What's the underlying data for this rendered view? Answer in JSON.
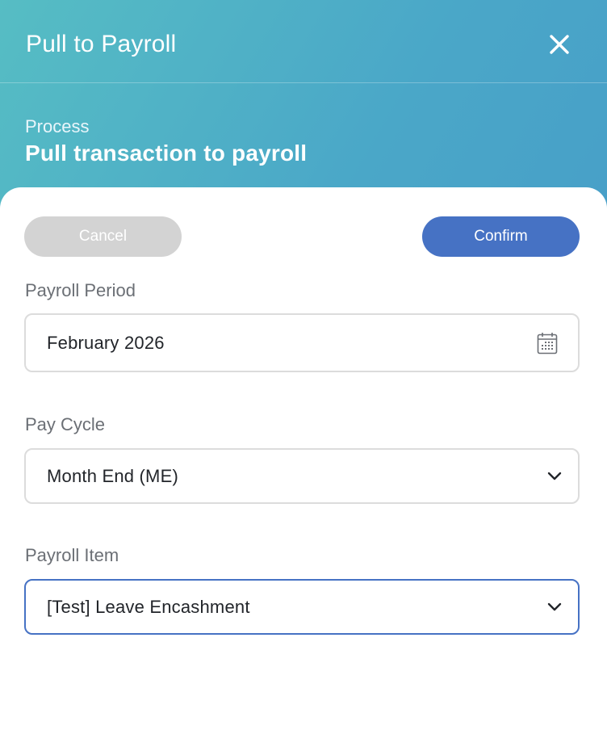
{
  "header": {
    "title": "Pull to Payroll",
    "close_icon": "close-icon"
  },
  "process": {
    "label": "Process",
    "title": "Pull transaction to payroll"
  },
  "actions": {
    "cancel_label": "Cancel",
    "confirm_label": "Confirm"
  },
  "form": {
    "payroll_period": {
      "label": "Payroll Period",
      "value": "February 2026",
      "icon": "calendar-icon"
    },
    "pay_cycle": {
      "label": "Pay Cycle",
      "value": "Month End (ME)",
      "icon": "chevron-down-icon"
    },
    "payroll_item": {
      "label": "Payroll Item",
      "value": "[Test] Leave Encashment",
      "icon": "chevron-down-icon"
    }
  },
  "colors": {
    "gradient_start": "#56bdc4",
    "gradient_end": "#4598c9",
    "confirm": "#4672c4",
    "cancel": "#d3d3d3",
    "focus_border": "#4672c4"
  }
}
